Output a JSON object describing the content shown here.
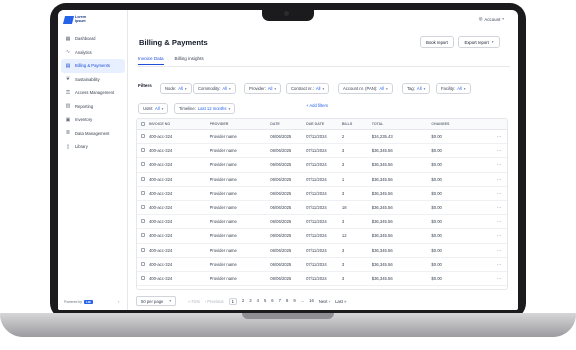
{
  "brand": {
    "logo_text_1": "Lorem",
    "logo_text_2": "Ipsum"
  },
  "sidebar": {
    "items": [
      {
        "label": "Dashboard",
        "icon": "grid-icon",
        "glyph": "▦"
      },
      {
        "label": "Analytics",
        "icon": "chart-line-icon",
        "glyph": "∿"
      },
      {
        "label": "Billing & Payments",
        "icon": "receipt-icon",
        "glyph": "▤"
      },
      {
        "label": "Sustainability",
        "icon": "leaf-icon",
        "glyph": "❦"
      },
      {
        "label": "Access Management",
        "icon": "key-icon",
        "glyph": "⚿"
      },
      {
        "label": "Reporting",
        "icon": "report-icon",
        "glyph": "▥"
      },
      {
        "label": "Inventory",
        "icon": "box-icon",
        "glyph": "▣"
      },
      {
        "label": "Data Management",
        "icon": "database-icon",
        "glyph": "≣"
      },
      {
        "label": "Library",
        "icon": "book-icon",
        "glyph": "▯"
      }
    ],
    "powered_label": "Powered by",
    "powered_badge": "LIB",
    "collapse_glyph": "‹"
  },
  "header": {
    "account_label": "Account",
    "account_glyph": "◎",
    "page_title": "Billing & Payments",
    "book_report": "Book report",
    "export_report": "Export report",
    "export_caret": "▾"
  },
  "tabs": [
    {
      "label": "Invoice Data"
    },
    {
      "label": "Billing insights"
    }
  ],
  "filters": {
    "label": "Filters",
    "chips": [
      {
        "key": "Node:",
        "value": "All"
      },
      {
        "key": "Commodity:",
        "value": "All"
      },
      {
        "key": "Provider:",
        "value": "All"
      },
      {
        "key": "Contract nr.:",
        "value": "All"
      },
      {
        "key": "Account nr. (PAN):",
        "value": "All"
      },
      {
        "key": "Tag:",
        "value": "All"
      },
      {
        "key": "Facility:",
        "value": "All"
      },
      {
        "key": "UoM:",
        "value": "All"
      },
      {
        "key": "Timeline:",
        "value": "Last 12 months"
      }
    ],
    "add_filters": "+ Add filters"
  },
  "table": {
    "columns": [
      "INVOICE NO",
      "PROVIDER",
      "DATE",
      "DUE DATE",
      "BILLS",
      "TOTAL",
      "CHANGES"
    ],
    "rows": [
      [
        "400-acc-324",
        "Provider name",
        "06/06/2025",
        "07/11/2024",
        "2",
        "$34,235.43",
        "$0.00"
      ],
      [
        "400-acc-324",
        "Provider name",
        "06/06/2025",
        "07/11/2024",
        "3",
        "$36,345.56",
        "$0.00"
      ],
      [
        "400-acc-324",
        "Provider name",
        "06/06/2025",
        "07/11/2024",
        "3",
        "$36,345.56",
        "$0.00"
      ],
      [
        "400-acc-324",
        "Provider name",
        "06/06/2025",
        "07/11/2024",
        "1",
        "$36,345.56",
        "$0.00"
      ],
      [
        "400-acc-324",
        "Provider name",
        "06/06/2025",
        "07/11/2024",
        "3",
        "$36,345.56",
        "$0.00"
      ],
      [
        "400-acc-324",
        "Provider name",
        "06/06/2025",
        "07/11/2024",
        "18",
        "$36,345.56",
        "$0.00"
      ],
      [
        "400-acc-324",
        "Provider name",
        "06/06/2025",
        "07/11/2024",
        "3",
        "$36,345.56",
        "$0.00"
      ],
      [
        "400-acc-324",
        "Provider name",
        "06/06/2025",
        "07/11/2024",
        "12",
        "$36,345.56",
        "$0.00"
      ],
      [
        "400-acc-324",
        "Provider name",
        "06/06/2025",
        "07/11/2024",
        "3",
        "$36,345.56",
        "$0.00"
      ],
      [
        "400-acc-324",
        "Provider name",
        "06/06/2025",
        "07/11/2024",
        "3",
        "$36,345.56",
        "$0.00"
      ],
      [
        "400-acc-324",
        "Provider name",
        "06/06/2025",
        "07/11/2024",
        "3",
        "$36,345.56",
        "$0.00"
      ]
    ],
    "row_menu_glyph": "···"
  },
  "pagination": {
    "per_page": "50 per page",
    "per_page_caret": "▾",
    "first": "« First",
    "previous": "‹ Previous",
    "pages": [
      "1",
      "2",
      "3",
      "4",
      "5",
      "6",
      "7",
      "8",
      "9",
      "...",
      "16"
    ],
    "current": "1",
    "next": "Next ›",
    "last": "Last »"
  },
  "colors": {
    "accent": "#2563eb",
    "active_bg": "#e8efff",
    "bezel": "#1b1b1d"
  }
}
